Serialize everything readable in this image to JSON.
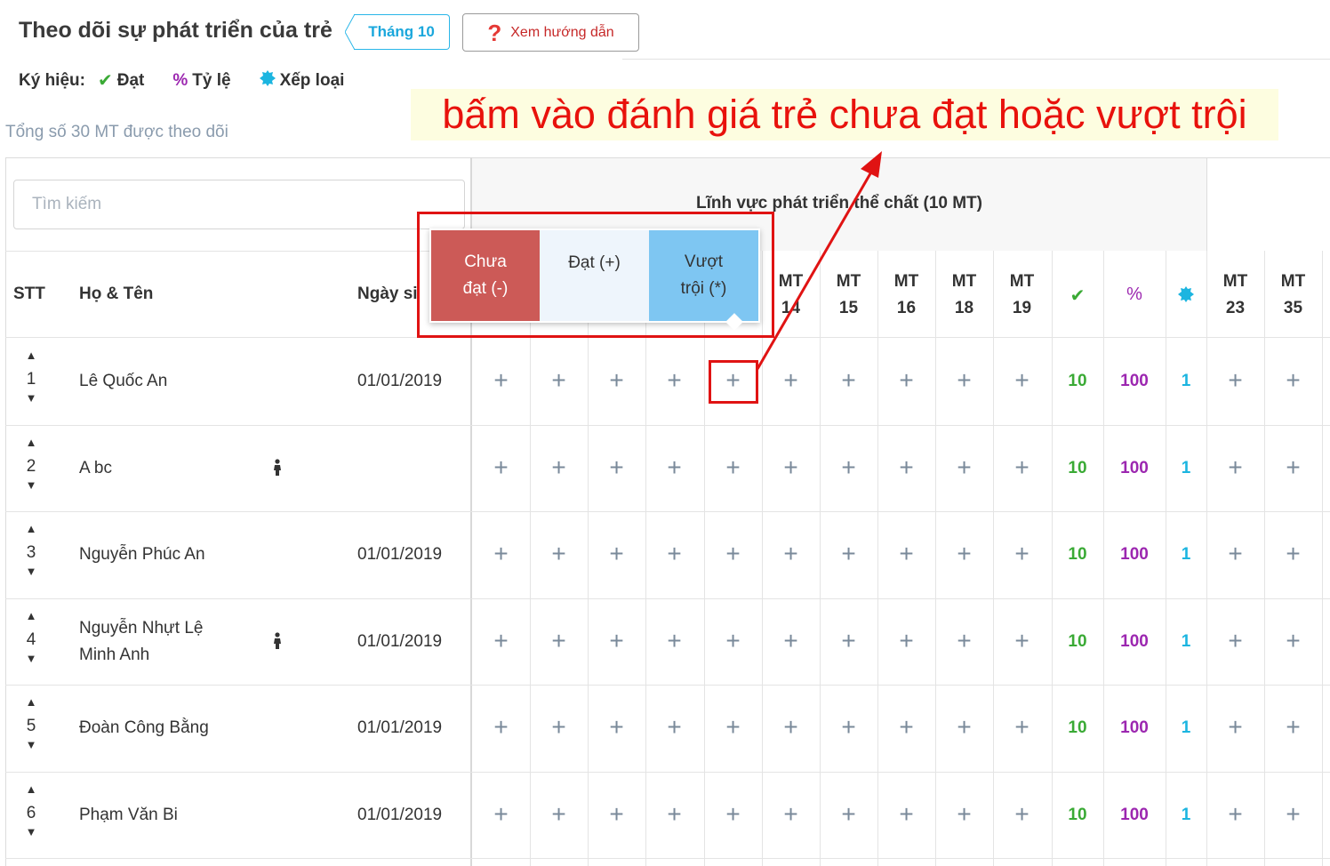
{
  "header": {
    "title": "Theo dõi sự phát triển của trẻ",
    "month": "Tháng 10",
    "guide_label": "Xem hướng dẫn"
  },
  "legend": {
    "label": "Ký hiệu:",
    "items": [
      {
        "icon": "check-icon",
        "label": "Đạt"
      },
      {
        "icon": "percent-icon",
        "label": "Tỷ lệ"
      },
      {
        "icon": "badge-icon",
        "label": "Xếp loại"
      }
    ]
  },
  "total_text": "Tổng số 30 MT được theo dõi",
  "annotation": "bấm vào đánh giá trẻ chưa đạt hoặc vượt trội",
  "search": {
    "placeholder": "Tìm kiếm"
  },
  "table": {
    "group_title": "Lĩnh vực phát triển thể chất (10 MT)",
    "col_stt": "STT",
    "col_name": "Họ & Tên",
    "col_dob": "Ngày si",
    "mt_visible": [
      {
        "top": "MT",
        "bottom": "14"
      },
      {
        "top": "MT",
        "bottom": "15"
      },
      {
        "top": "MT",
        "bottom": "16"
      },
      {
        "top": "MT",
        "bottom": "18"
      },
      {
        "top": "MT",
        "bottom": "19"
      }
    ],
    "mt_after": [
      {
        "top": "MT",
        "bottom": "23"
      },
      {
        "top": "MT",
        "bottom": "35"
      }
    ],
    "header_icons": {
      "check": "✔",
      "percent": "%",
      "badge": "✹"
    },
    "cell_symbol": "+",
    "rows": [
      {
        "stt": "1",
        "name_line1": "Lê Quốc An",
        "name_line2": "",
        "dob": "01/01/2019",
        "ok": "10",
        "pct": "100",
        "rank": "1",
        "gender": false
      },
      {
        "stt": "2",
        "name_line1": "A bc",
        "name_line2": "",
        "dob": "",
        "ok": "10",
        "pct": "100",
        "rank": "1",
        "gender": true
      },
      {
        "stt": "3",
        "name_line1": "Nguyễn Phúc An",
        "name_line2": "",
        "dob": "01/01/2019",
        "ok": "10",
        "pct": "100",
        "rank": "1",
        "gender": false
      },
      {
        "stt": "4",
        "name_line1": "Nguyễn Nhựt Lệ",
        "name_line2": "Minh Anh",
        "dob": "01/01/2019",
        "ok": "10",
        "pct": "100",
        "rank": "1",
        "gender": true
      },
      {
        "stt": "5",
        "name_line1": "Đoàn Công Bằng",
        "name_line2": "",
        "dob": "01/01/2019",
        "ok": "10",
        "pct": "100",
        "rank": "1",
        "gender": false
      },
      {
        "stt": "6",
        "name_line1": "Phạm Văn Bi",
        "name_line2": "",
        "dob": "01/01/2019",
        "ok": "10",
        "pct": "100",
        "rank": "1",
        "gender": false
      }
    ]
  },
  "popup": {
    "bad_line1": "Chưa",
    "bad_line2": "đạt (-)",
    "ok": "Đạt (+)",
    "exc_line1": "Vượt",
    "exc_line2": "trội (*)"
  },
  "colors": {
    "accent_blue": "#1aa7dc",
    "ok_green": "#3aaa35",
    "pct_purple": "#9c27b0",
    "annotation_red": "#e8120c",
    "bad_red": "#cc5a57",
    "exc_blue": "#7ec6f2"
  }
}
